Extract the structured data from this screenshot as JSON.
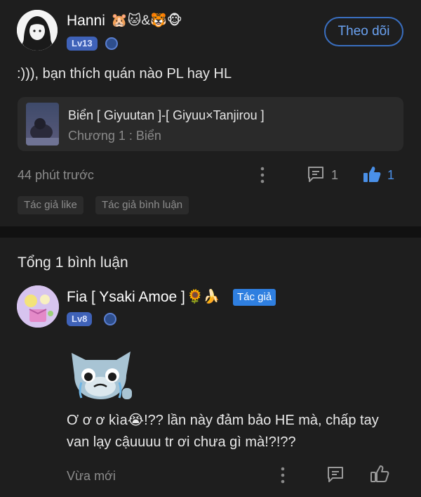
{
  "post": {
    "user_name": "Hanni",
    "user_emoji": "🐹🐱&🐯🐵",
    "level": "Lv13",
    "follow_label": "Theo dõi",
    "content": ":))), bạn thích quán nào PL hay HL",
    "linked_story": {
      "title": "Biển [ Giyuutan ]-[ Giyuu×Tanjirou ]",
      "chapter": "Chương 1 : Biển"
    },
    "time": "44 phút trước",
    "comment_count": "1",
    "like_count": "1",
    "tags": [
      "Tác giả like",
      "Tác giả bình luận"
    ]
  },
  "comments_section": {
    "total_label": "Tổng 1 bình luận"
  },
  "comment": {
    "user_name": "Fia [ Ysaki Amoe ]",
    "user_emoji": "🌻🍌",
    "author_badge": "Tác giả",
    "level": "Lv8",
    "content_line1": "Ơ ơ ơ kìa😭!?? lần này đảm bảo HE mà, chấp tay",
    "content_line2": "van lạy cậuuuu tr ơi chưa gì mà!?!??",
    "time": "Vừa mới"
  },
  "colors": {
    "background": "#1e1e1e",
    "accent_blue": "#3f7fe0",
    "card": "#2a2a2a"
  }
}
